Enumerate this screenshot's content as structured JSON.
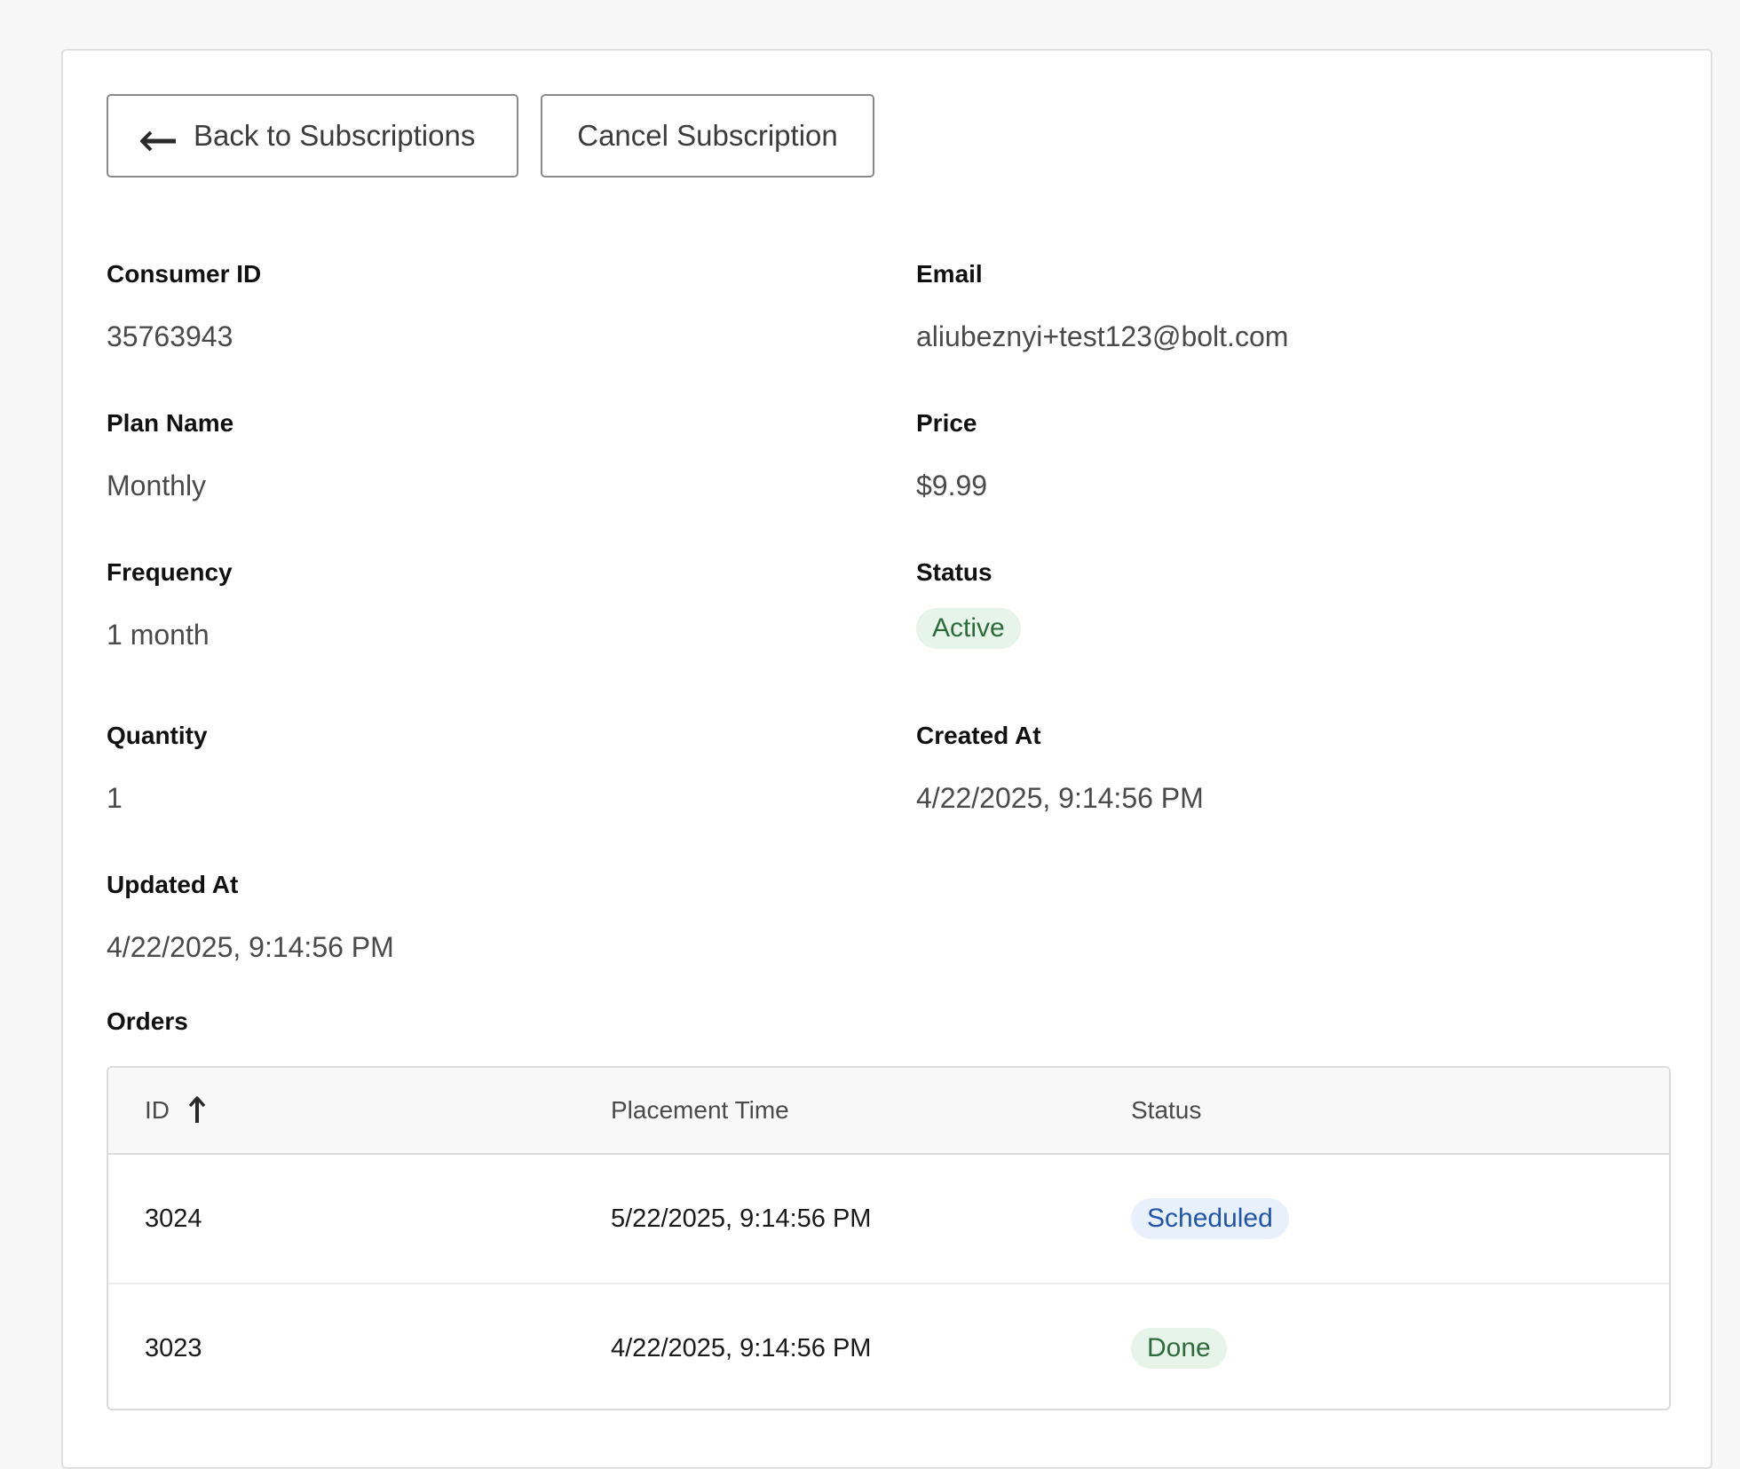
{
  "toolbar": {
    "back_label": "Back to Subscriptions",
    "back_icon": "arrow-left-icon",
    "cancel_label": "Cancel Subscription"
  },
  "details": {
    "consumer_id": {
      "label": "Consumer ID",
      "value": "35763943"
    },
    "email": {
      "label": "Email",
      "value": "aliubeznyi+test123@bolt.com"
    },
    "plan_name": {
      "label": "Plan Name",
      "value": "Monthly"
    },
    "price": {
      "label": "Price",
      "value": "$9.99"
    },
    "frequency": {
      "label": "Frequency",
      "value": "1 month"
    },
    "status": {
      "label": "Status",
      "value": "Active"
    },
    "quantity": {
      "label": "Quantity",
      "value": "1"
    },
    "created_at": {
      "label": "Created At",
      "value": "4/22/2025, 9:14:56 PM"
    },
    "updated_at": {
      "label": "Updated At",
      "value": "4/22/2025, 9:14:56 PM"
    }
  },
  "orders": {
    "title": "Orders",
    "columns": {
      "id": "ID",
      "placement_time": "Placement Time",
      "status": "Status"
    },
    "sort_icon": "arrow-up-icon",
    "rows": [
      {
        "id": "3024",
        "placement_time": "5/22/2025, 9:14:56 PM",
        "status": "Scheduled"
      },
      {
        "id": "3023",
        "placement_time": "4/22/2025, 9:14:56 PM",
        "status": "Done"
      }
    ]
  },
  "colors": {
    "active_bg": "#e6f4ea",
    "active_text": "#2e6b3a",
    "scheduled_bg": "#e8f0fc",
    "scheduled_text": "#2055a8"
  }
}
